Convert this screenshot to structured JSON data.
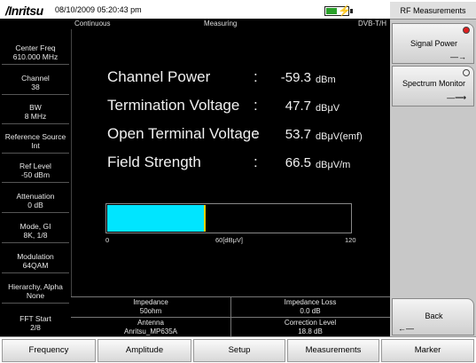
{
  "header": {
    "logo": "/Inritsu",
    "datetime": "08/10/2009 05:20:43 pm",
    "battery_level_percent": 50
  },
  "status": {
    "sweep_mode": "Continuous",
    "state": "Measuring",
    "standard": "DVB-T/H"
  },
  "left_panel": [
    {
      "label": "Center Freq",
      "value": "610.000 MHz"
    },
    {
      "label": "Channel",
      "value": "38"
    },
    {
      "label": "BW",
      "value": "8 MHz"
    },
    {
      "label": "Reference Source",
      "value": "Int"
    },
    {
      "label": "Ref Level",
      "value": "-50 dBm"
    },
    {
      "label": "Attenuation",
      "value": "0 dB"
    },
    {
      "label": "Mode, GI",
      "value": "8K, 1/8"
    },
    {
      "label": "Modulation",
      "value": "64QAM"
    },
    {
      "label": "Hierarchy, Alpha",
      "value": "None"
    },
    {
      "label": "FFT Start",
      "value": "2/8"
    }
  ],
  "measurements": [
    {
      "label": "Channel Power",
      "colon": ":",
      "value": "-59.3",
      "unit": "dBm"
    },
    {
      "label": "Termination Voltage",
      "colon": ":",
      "value": "47.7",
      "unit": "dBμV"
    },
    {
      "label": "Open Terminal Voltage",
      "colon": ":",
      "value": "53.7",
      "unit": "dBμV(emf)"
    },
    {
      "label": "Field Strength",
      "colon": ":",
      "value": "66.5",
      "unit": "dBμV/m"
    }
  ],
  "bargraph": {
    "min": 0,
    "max": 120,
    "value": 47.7,
    "tick_min": "0",
    "tick_mid": "60[dBμV]",
    "tick_max": "120",
    "fill_color": "#00e5ff"
  },
  "info": {
    "impedance_label": "Impedance",
    "impedance_value": "50ohm",
    "impedance_loss_label": "Impedance Loss",
    "impedance_loss_value": "0.0 dB",
    "antenna_label": "Antenna",
    "antenna_value": "Anritsu_MP635A",
    "correction_label": "Correction Level",
    "correction_value": "18.8 dB"
  },
  "right_panel": {
    "title": "RF Measurements",
    "signal_power": "Signal Power",
    "spectrum_monitor": "Spectrum Monitor",
    "back": "Back",
    "active_led_color": "#e02020"
  },
  "bottom_menu": [
    "Frequency",
    "Amplitude",
    "Setup",
    "Measurements",
    "Marker"
  ]
}
